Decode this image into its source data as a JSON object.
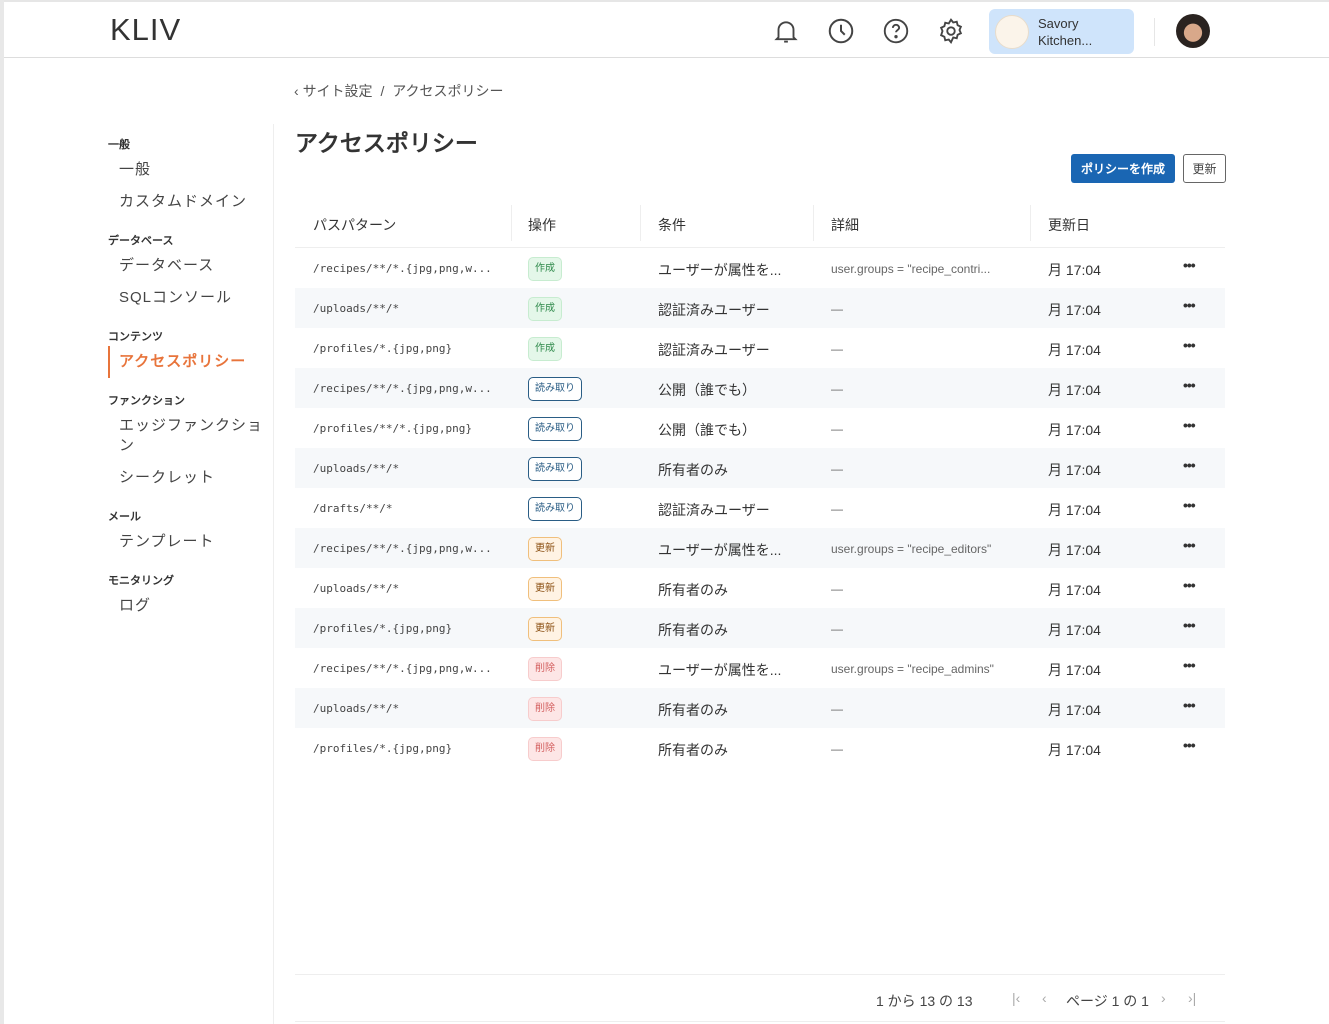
{
  "header": {
    "logo": "KLIV",
    "workspace_name": "Savory Kitchen...",
    "icons": [
      "bell-icon",
      "clock-icon",
      "help-icon",
      "gear-icon"
    ]
  },
  "breadcrumb": {
    "parent": "サイト設定",
    "separator": "/",
    "current": "アクセスポリシー"
  },
  "sidebar": {
    "sections": [
      {
        "label": "一般",
        "items": [
          "一般",
          "カスタムドメイン"
        ]
      },
      {
        "label": "データベース",
        "items": [
          "データベース",
          "SQLコンソール"
        ]
      },
      {
        "label": "コンテンツ",
        "items": [
          "アクセスポリシー"
        ]
      },
      {
        "label": "ファンクション",
        "items": [
          "エッジファンクション",
          "シークレット"
        ]
      },
      {
        "label": "メール",
        "items": [
          "テンプレート"
        ]
      },
      {
        "label": "モニタリング",
        "items": [
          "ログ"
        ]
      }
    ],
    "active": "アクセスポリシー"
  },
  "page": {
    "title": "アクセスポリシー",
    "create_button": "ポリシーを作成",
    "refresh_button": "更新"
  },
  "table": {
    "columns": [
      "パスパターン",
      "操作",
      "条件",
      "詳細",
      "更新日"
    ],
    "rows": [
      {
        "path": "/recipes/**/*.{jpg,png,w...",
        "op": "作成",
        "type": "create",
        "cond": "ユーザーが属性を...",
        "detail": "user.groups = \"recipe_contri...",
        "date": "月 17:04"
      },
      {
        "path": "/uploads/**/*",
        "op": "作成",
        "type": "create",
        "cond": "認証済みユーザー",
        "detail": "—",
        "date": "月 17:04"
      },
      {
        "path": "/profiles/*.{jpg,png}",
        "op": "作成",
        "type": "create",
        "cond": "認証済みユーザー",
        "detail": "—",
        "date": "月 17:04"
      },
      {
        "path": "/recipes/**/*.{jpg,png,w...",
        "op": "読み取り",
        "type": "read",
        "cond": "公開（誰でも）",
        "detail": "—",
        "date": "月 17:04"
      },
      {
        "path": "/profiles/**/*.{jpg,png}",
        "op": "読み取り",
        "type": "read",
        "cond": "公開（誰でも）",
        "detail": "—",
        "date": "月 17:04"
      },
      {
        "path": "/uploads/**/*",
        "op": "読み取り",
        "type": "read",
        "cond": "所有者のみ",
        "detail": "—",
        "date": "月 17:04"
      },
      {
        "path": "/drafts/**/*",
        "op": "読み取り",
        "type": "read",
        "cond": "認証済みユーザー",
        "detail": "—",
        "date": "月 17:04"
      },
      {
        "path": "/recipes/**/*.{jpg,png,w...",
        "op": "更新",
        "type": "update",
        "cond": "ユーザーが属性を...",
        "detail": "user.groups = \"recipe_editors\"",
        "date": "月 17:04"
      },
      {
        "path": "/uploads/**/*",
        "op": "更新",
        "type": "update",
        "cond": "所有者のみ",
        "detail": "—",
        "date": "月 17:04"
      },
      {
        "path": "/profiles/*.{jpg,png}",
        "op": "更新",
        "type": "update",
        "cond": "所有者のみ",
        "detail": "—",
        "date": "月 17:04"
      },
      {
        "path": "/recipes/**/*.{jpg,png,w...",
        "op": "削除",
        "type": "delete",
        "cond": "ユーザーが属性を...",
        "detail": "user.groups = \"recipe_admins\"",
        "date": "月 17:04"
      },
      {
        "path": "/uploads/**/*",
        "op": "削除",
        "type": "delete",
        "cond": "所有者のみ",
        "detail": "—",
        "date": "月 17:04"
      },
      {
        "path": "/profiles/*.{jpg,png}",
        "op": "削除",
        "type": "delete",
        "cond": "所有者のみ",
        "detail": "—",
        "date": "月 17:04"
      }
    ]
  },
  "pagination": {
    "count": "1 から 13 の 13",
    "page": "ページ 1 の 1"
  }
}
